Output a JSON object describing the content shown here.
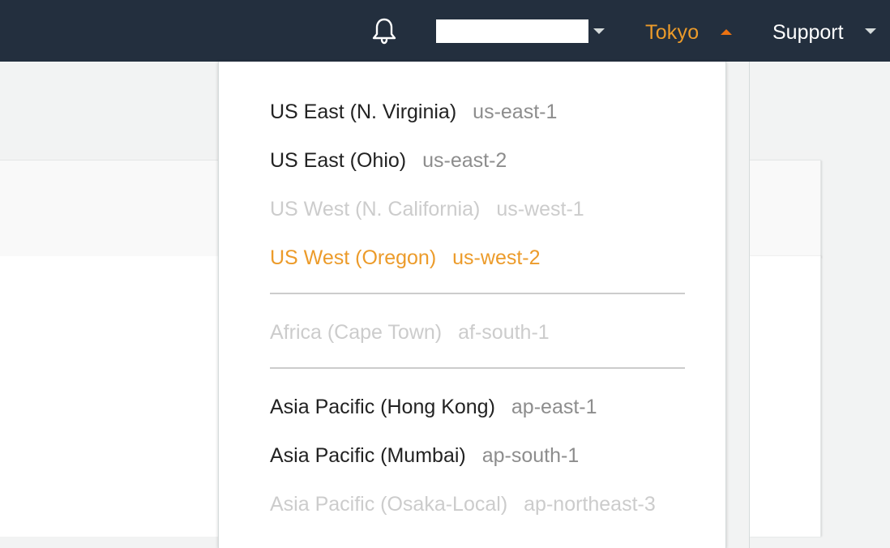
{
  "topbar": {
    "notifications_icon": "bell-icon",
    "account_value": "",
    "region_label": "Tokyo",
    "support_label": "Support"
  },
  "colors": {
    "topbar_bg": "#232f3e",
    "accent": "#ec9b2a",
    "enabled_text": "#222222",
    "code_text": "#8d8d8d",
    "disabled_text": "#cccccc"
  },
  "regions": {
    "groups": [
      {
        "items": [
          {
            "name": "US East (N. Virginia)",
            "code": "us-east-1",
            "status": "enabled"
          },
          {
            "name": "US East (Ohio)",
            "code": "us-east-2",
            "status": "enabled"
          },
          {
            "name": "US West (N. California)",
            "code": "us-west-1",
            "status": "disabled"
          },
          {
            "name": "US West (Oregon)",
            "code": "us-west-2",
            "status": "selected"
          }
        ]
      },
      {
        "items": [
          {
            "name": "Africa (Cape Town)",
            "code": "af-south-1",
            "status": "disabled"
          }
        ]
      },
      {
        "items": [
          {
            "name": "Asia Pacific (Hong Kong)",
            "code": "ap-east-1",
            "status": "enabled"
          },
          {
            "name": "Asia Pacific (Mumbai)",
            "code": "ap-south-1",
            "status": "enabled"
          },
          {
            "name": "Asia Pacific (Osaka-Local)",
            "code": "ap-northeast-3",
            "status": "disabled"
          }
        ]
      }
    ]
  }
}
